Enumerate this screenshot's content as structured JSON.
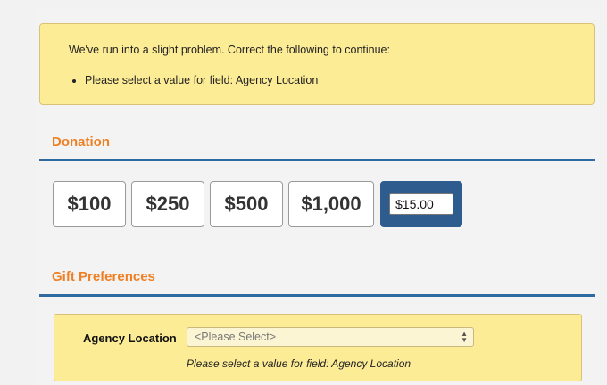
{
  "error_box": {
    "message": "We've run into a slight problem. Correct the following to continue:",
    "items": [
      "Please select a value for field: Agency Location"
    ]
  },
  "donation": {
    "title": "Donation",
    "amounts": [
      "$100",
      "$250",
      "$500",
      "$1,000"
    ],
    "other_amount_value": "$15.00"
  },
  "gift_preferences": {
    "title": "Gift Preferences",
    "agency_location_label": "Agency Location",
    "agency_location_selected": "<Please Select>",
    "agency_location_error": "Please select a value for field: Agency Location"
  },
  "colors": {
    "accent_orange": "#ef7f23",
    "rule_blue": "#2f6aa0",
    "selected_button": "#2f5c8f",
    "alert_yellow": "#fdec96"
  }
}
